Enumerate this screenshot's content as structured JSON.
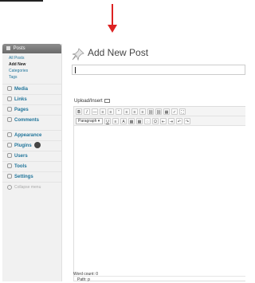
{
  "sidebar": {
    "posts_label": "Posts",
    "posts_sub": [
      "All Posts",
      "Add New",
      "Categories",
      "Tags"
    ],
    "items": [
      {
        "label": "Media"
      },
      {
        "label": "Links"
      },
      {
        "label": "Pages"
      },
      {
        "label": "Comments"
      },
      {
        "label": "Appearance"
      },
      {
        "label": "Plugins"
      },
      {
        "label": "Users"
      },
      {
        "label": "Tools"
      },
      {
        "label": "Settings"
      }
    ],
    "collapse_label": "Collapse menu"
  },
  "page": {
    "title": "Add New Post"
  },
  "editor": {
    "upload_label": "Upload/Insert",
    "toolbar_row1": [
      "B",
      "I",
      "—",
      "≡",
      "≡",
      "“",
      "≡",
      "≡",
      "≡",
      "⛓",
      "⛓",
      "▦",
      "✓",
      "⛶"
    ],
    "toolbar_row2_select": "Paragraph",
    "toolbar_row2": [
      "U",
      "≡",
      "A",
      "▦",
      "▦",
      "◌",
      "Ω",
      "⇤",
      "⇥",
      "↶",
      "↷"
    ],
    "path_label": "Path: p",
    "word_count_label": "Word count: 0"
  },
  "colors": {
    "accent": "#21759b",
    "arrow": "#dd2222",
    "posts_head": "#7a7a7a"
  }
}
